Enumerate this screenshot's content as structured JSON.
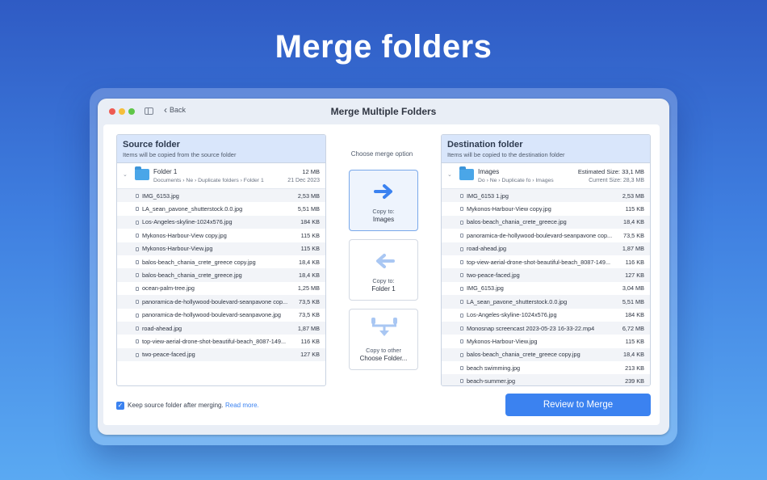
{
  "headline": "Merge folders",
  "window": {
    "title": "Merge Multiple Folders",
    "back_label": "Back"
  },
  "source": {
    "title": "Source folder",
    "subtitle": "Items will be copied from the source folder",
    "folder": {
      "name": "Folder 1",
      "path": "Documents  ›  Ne  ›  Duplicate folders  ›  Folder 1",
      "size": "12 MB",
      "date": "21 Dec 2023"
    },
    "files": [
      {
        "name": "IMG_6153.jpg",
        "size": "2,53 MB"
      },
      {
        "name": "LA_sean_pavone_shutterstock.0.0.jpg",
        "size": "5,51 MB"
      },
      {
        "name": "Los-Angeles-skyline-1024x576.jpg",
        "size": "184 KB"
      },
      {
        "name": "Mykonos-Harbour-View copy.jpg",
        "size": "115 KB"
      },
      {
        "name": "Mykonos-Harbour-View.jpg",
        "size": "115 KB"
      },
      {
        "name": "balos-beach_chania_crete_greece copy.jpg",
        "size": "18,4 KB"
      },
      {
        "name": "balos-beach_chania_crete_greece.jpg",
        "size": "18,4 KB"
      },
      {
        "name": "ocean-palm-tree.jpg",
        "size": "1,25 MB"
      },
      {
        "name": "panoramica-de-hollywood-boulevard-seanpavone cop...",
        "size": "73,5 KB"
      },
      {
        "name": "panoramica-de-hollywood-boulevard-seanpavone.jpg",
        "size": "73,5 KB"
      },
      {
        "name": "road-ahead.jpg",
        "size": "1,87 MB"
      },
      {
        "name": "top-view-aerial-drone-shot-beautiful-beach_8087-149...",
        "size": "116 KB"
      },
      {
        "name": "two-peace-faced.jpg",
        "size": "127 KB"
      }
    ]
  },
  "destination": {
    "title": "Destination folder",
    "subtitle": "Items will be copied to the destination folder",
    "folder": {
      "name": "Images",
      "path": "Do  ›  Ne  ›  Duplicate fo  ›  Images",
      "estimated_size": "Estimated Size: 33,1 MB",
      "current_size": "Current Size: 28,3 MB"
    },
    "files": [
      {
        "name": "IMG_6153 1.jpg",
        "size": "2,53 MB"
      },
      {
        "name": "Mykonos-Harbour-View copy.jpg",
        "size": "115 KB"
      },
      {
        "name": "balos-beach_chania_crete_greece.jpg",
        "size": "18,4 KB"
      },
      {
        "name": "panoramica-de-hollywood-boulevard-seanpavone cop...",
        "size": "73,5 KB"
      },
      {
        "name": "road-ahead.jpg",
        "size": "1,87 MB"
      },
      {
        "name": "top-view-aerial-drone-shot-beautiful-beach_8087-149...",
        "size": "116 KB"
      },
      {
        "name": "two-peace-faced.jpg",
        "size": "127 KB"
      },
      {
        "name": "IMG_6153.jpg",
        "size": "3,04 MB"
      },
      {
        "name": "LA_sean_pavone_shutterstock.0.0.jpg",
        "size": "5,51 MB"
      },
      {
        "name": "Los-Angeles-skyline-1024x576.jpg",
        "size": "184 KB"
      },
      {
        "name": "Monosnap screencast 2023-05-23 16-33-22.mp4",
        "size": "6,72 MB"
      },
      {
        "name": "Mykonos-Harbour-View.jpg",
        "size": "115 KB"
      },
      {
        "name": "balos-beach_chania_crete_greece copy.jpg",
        "size": "18,4 KB"
      },
      {
        "name": "beach swimming.jpg",
        "size": "213 KB"
      },
      {
        "name": "beach-summer.jpg",
        "size": "239 KB"
      }
    ]
  },
  "merge": {
    "label": "Choose merge option",
    "options": [
      {
        "line1": "Copy to:",
        "line2": "Images",
        "icon": "arrow-right-icon",
        "selected": true
      },
      {
        "line1": "Copy to:",
        "line2": "Folder 1",
        "icon": "arrow-left-icon",
        "selected": false
      },
      {
        "line1": "Copy to other",
        "line2": "Choose Folder...",
        "icon": "merge-branch-icon",
        "selected": false
      }
    ]
  },
  "footer": {
    "keep_label": "Keep source folder after merging.",
    "read_more": "Read more.",
    "review_button": "Review to Merge"
  },
  "colors": {
    "accent": "#3b82f0",
    "panel_header": "#d9e6fb",
    "folder": "#4aa6e8"
  }
}
